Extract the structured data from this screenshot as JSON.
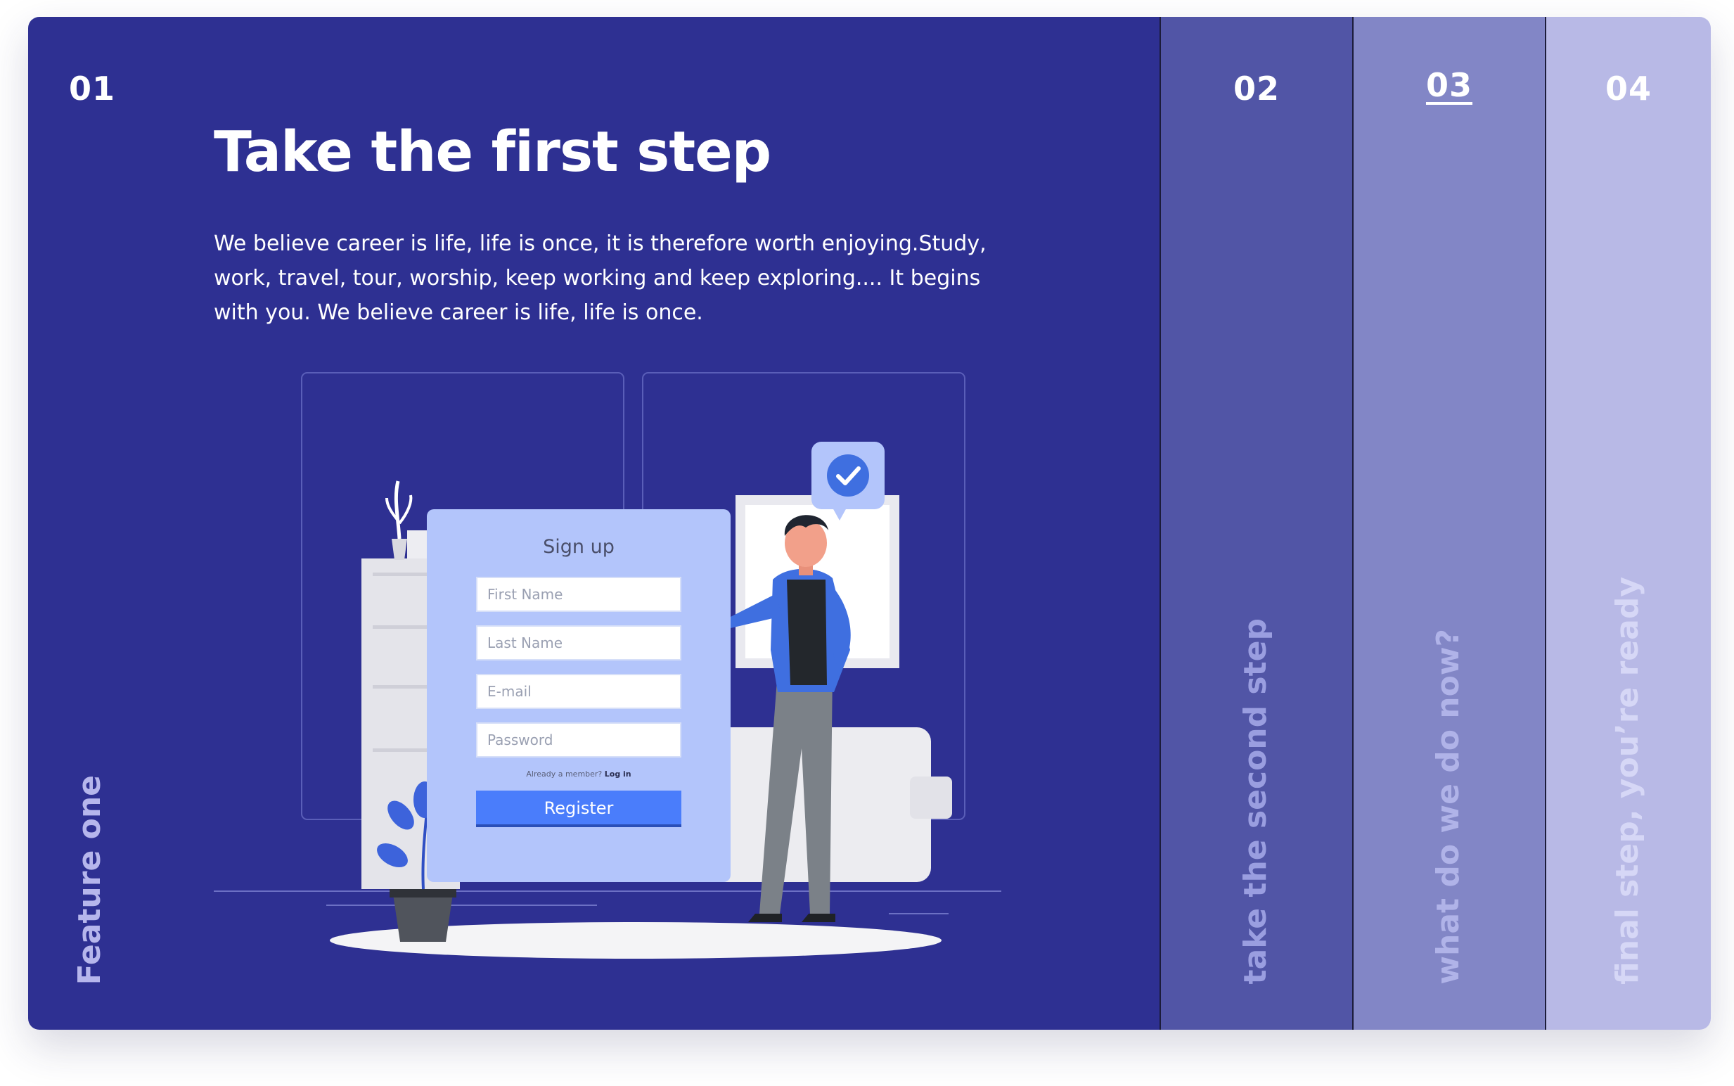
{
  "panels": [
    {
      "number": "01",
      "title": "Take the first step",
      "description": "We believe career is life, life is once, it is therefore worth enjoying.Study, work, travel, tour, worship, keep working and keep exploring.... It begins with you. We believe career is life, life is once.",
      "vertical_label": "Feature one"
    },
    {
      "number": "02",
      "vertical_label": "take the second step"
    },
    {
      "number": "03",
      "vertical_label": "what do we do now?"
    },
    {
      "number": "04",
      "vertical_label": "final step, you’re ready"
    }
  ],
  "signup_form": {
    "title": "Sign up",
    "first_name_placeholder": "First Name",
    "last_name_placeholder": "Last Name",
    "email_placeholder": "E-mail",
    "password_placeholder": "Password",
    "member_text": "Already a member?",
    "login_link": "Log in",
    "register_label": "Register"
  },
  "colors": {
    "panel_1_bg": "#2e3092",
    "panel_2_bg": "#5155a6",
    "panel_3_bg": "#8286c6",
    "panel_4_bg": "#b8b9e6",
    "accent_blue": "#4a7dfb"
  },
  "icons": [
    "check-badge-icon"
  ]
}
